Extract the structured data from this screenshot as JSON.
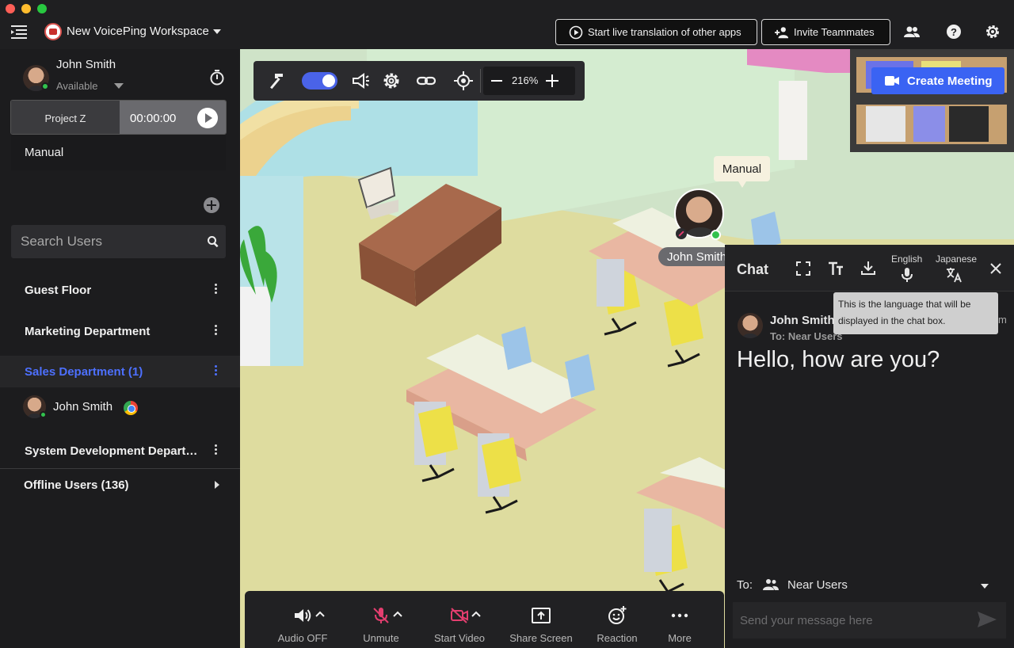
{
  "window": {
    "workspace_name": "New VoicePing Workspace"
  },
  "header": {
    "translate_button": "Start live translation of other apps",
    "invite_button": "Invite Teammates"
  },
  "sidebar": {
    "user": {
      "name": "John Smith",
      "status": "Available"
    },
    "project": {
      "name": "Project Z",
      "timer": "00:00:00"
    },
    "mode": "Manual",
    "search_placeholder": "Search Users",
    "groups": [
      {
        "label": "Guest Floor"
      },
      {
        "label": "Marketing Department"
      },
      {
        "label": "Sales Department (1)",
        "active": true
      },
      {
        "label": "System Development Depart…"
      }
    ],
    "members": [
      {
        "name": "John Smith",
        "app": "chrome-icon"
      }
    ],
    "offline_label": "Offline Users (136)"
  },
  "map": {
    "zoom": "216%",
    "create_meeting": "Create Meeting",
    "bubble_text": "Manual",
    "avatar_name": "John Smith"
  },
  "bottom_bar": {
    "audio": "Audio OFF",
    "mic": "Unmute",
    "video": "Start Video",
    "share": "Share Screen",
    "reaction": "Reaction",
    "more": "More"
  },
  "chat": {
    "title": "Chat",
    "lang_source": "English",
    "lang_target": "Japanese",
    "tooltip": "This is the language that will be displayed in the chat box.",
    "message": {
      "sender": "John Smith",
      "time_fragment": "m",
      "to": "To: Near Users",
      "text": "Hello, how are you?"
    },
    "to_label": "To:",
    "to_value": "Near Users",
    "input_placeholder": "Send your message here"
  },
  "colors": {
    "accent": "#3a63f3",
    "active_group": "#4d70ff",
    "online": "#32c24d",
    "muted_red": "#e33e6f",
    "floor": "#dedc9f"
  }
}
